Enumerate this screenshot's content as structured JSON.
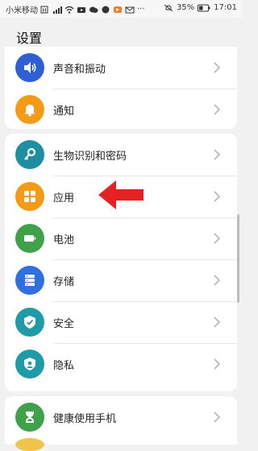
{
  "status_bar": {
    "carrier": "小米移动",
    "battery": "35%",
    "time": "17:01"
  },
  "title": "设置",
  "sections": [
    {
      "items": [
        {
          "label": "声音和振动",
          "icon": "sound-icon",
          "color": "#2f5fd4"
        },
        {
          "label": "通知",
          "icon": "bell-icon",
          "color": "#f39a16"
        }
      ]
    },
    {
      "items": [
        {
          "label": "生物识别和密码",
          "icon": "key-icon",
          "color": "#1f8ea1"
        },
        {
          "label": "应用",
          "icon": "apps-grid-icon",
          "color": "#f39a16"
        },
        {
          "label": "电池",
          "icon": "battery-icon",
          "color": "#3fa14a"
        },
        {
          "label": "存储",
          "icon": "storage-icon",
          "color": "#2f6fe0"
        },
        {
          "label": "安全",
          "icon": "shield-icon",
          "color": "#1f9aa7"
        },
        {
          "label": "隐私",
          "icon": "privacy-icon",
          "color": "#1f9aa7"
        }
      ]
    },
    {
      "items": [
        {
          "label": "健康使用手机",
          "icon": "hourglass-icon",
          "color": "#3fa14a"
        }
      ]
    }
  ],
  "annotation": {
    "arrow_color": "#e32222"
  }
}
